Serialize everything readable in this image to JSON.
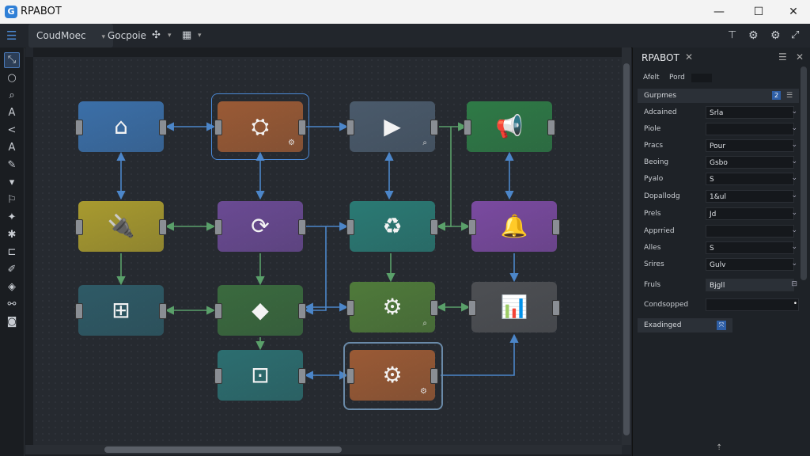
{
  "app": {
    "title": "RPABOT"
  },
  "window": {
    "minimize": "—",
    "maximize": "☐",
    "close": "✕"
  },
  "toolbar": {
    "tab1": "CoudMoec",
    "tab2": "Gocpoie"
  },
  "panel": {
    "title": "RPABOT",
    "tab_a": "Afelt",
    "tab_b": "Pord",
    "section1": "Gurpmes",
    "rows": [
      {
        "label": "Adcained",
        "value": "Srla"
      },
      {
        "label": "Piole",
        "value": ""
      },
      {
        "label": "Pracs",
        "value": "Pour"
      },
      {
        "label": "Beoing",
        "value": "Gsbo"
      },
      {
        "label": "Pyalo",
        "value": "S"
      },
      {
        "label": "Dopallodg",
        "value": "1&ul"
      },
      {
        "label": "Prels",
        "value": "Jd"
      },
      {
        "label": "Apprried",
        "value": ""
      },
      {
        "label": "Alles",
        "value": "S"
      },
      {
        "label": "Srires",
        "value": "Gulv"
      }
    ],
    "fruls": {
      "label": "Fruls",
      "value": "Bjgll"
    },
    "condsopped": "Condsopped",
    "expanded": "Exadinged"
  },
  "nodes": [
    {
      "id": "n1",
      "icon": "⌂",
      "color": "#3b6fa8"
    },
    {
      "id": "n2",
      "icon": "⛭",
      "color": "#9a5a35",
      "mini": "⚙"
    },
    {
      "id": "n3",
      "icon": "▶",
      "color": "#4a5a6b",
      "mini": "⌕"
    },
    {
      "id": "n4",
      "icon": "📢",
      "color": "#2e7a46"
    },
    {
      "id": "n5",
      "icon": "🔌",
      "color": "#a89a2f"
    },
    {
      "id": "n6",
      "icon": "⟳",
      "color": "#6a4a93"
    },
    {
      "id": "n7",
      "icon": "♻",
      "color": "#2a7a74"
    },
    {
      "id": "n8",
      "icon": "🔔",
      "color": "#7a4aa0"
    },
    {
      "id": "n9",
      "icon": "⊞",
      "color": "#2e5a66"
    },
    {
      "id": "n10",
      "icon": "◆",
      "color": "#3a6a3e"
    },
    {
      "id": "n11",
      "icon": "⚙",
      "color": "#4f7a3a",
      "mini": "⌕"
    },
    {
      "id": "n12",
      "icon": "📊",
      "color": "#4d4f53"
    },
    {
      "id": "n13",
      "icon": "⊡",
      "color": "#2c6e70"
    },
    {
      "id": "n14",
      "icon": "⚙",
      "color": "#9a5a35",
      "mini": "⚙"
    }
  ],
  "colors": {
    "accent": "#4c8ad6",
    "arrow_blue": "#4c86c9",
    "arrow_green": "#5aa06a"
  }
}
